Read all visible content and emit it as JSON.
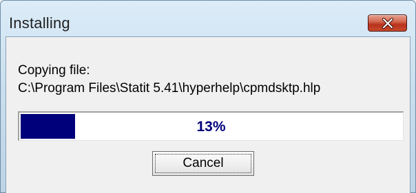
{
  "window": {
    "title": "Installing",
    "close_icon": "close-x-icon"
  },
  "status": {
    "label": "Copying file:",
    "path": "C:\\Program Files\\Statit 5.41\\hyperhelp\\cpmdsktp.hlp"
  },
  "progress": {
    "value": 0.13,
    "text": "13%",
    "fill_color": "#00007b"
  },
  "buttons": {
    "cancel_label": "Cancel"
  }
}
